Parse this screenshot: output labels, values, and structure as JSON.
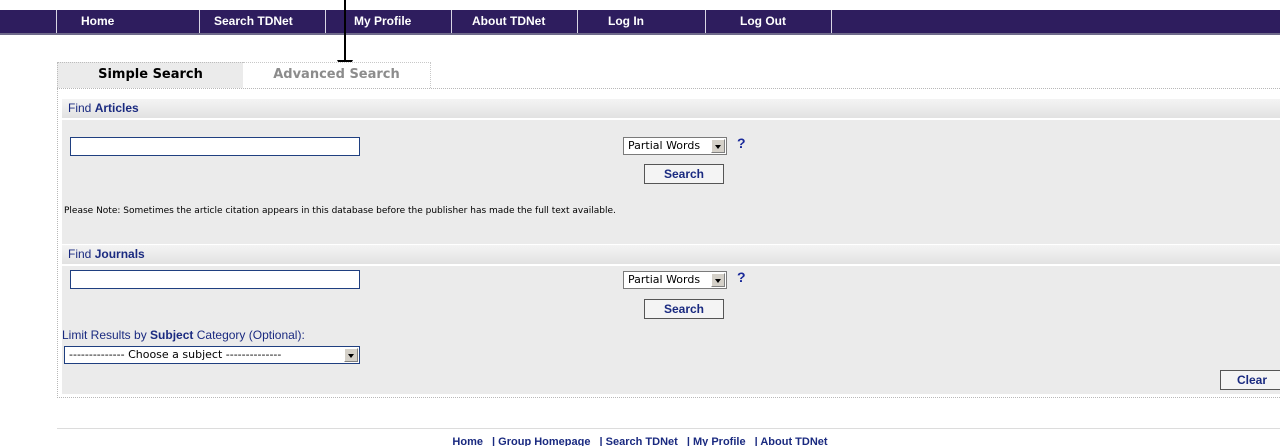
{
  "nav": {
    "items": [
      "Home",
      "Search TDNet",
      "My Profile",
      "About TDNet",
      "Log In",
      "Log Out"
    ]
  },
  "tabs": {
    "simple": "Simple Search",
    "advanced": "Advanced Search"
  },
  "articles": {
    "header_prefix": "Find",
    "header_bold": "Articles",
    "input_value": "",
    "match_select": "Partial Words",
    "help": "?",
    "search_button": "Search",
    "note": "Please Note: Sometimes the article citation appears in this database before the publisher has made the full text available."
  },
  "journals": {
    "header_prefix": "Find",
    "header_bold": "Journals",
    "input_value": "",
    "match_select": "Partial Words",
    "help": "?",
    "search_button": "Search",
    "limit_prefix": "Limit Results by",
    "limit_bold": "Subject",
    "limit_suffix": "Category (Optional):",
    "subject_select": "-------------- Choose a subject --------------",
    "clear_button": "Clear"
  },
  "footer": {
    "links": [
      "Home",
      "| Group Homepage",
      "| Search TDNet",
      "| My Profile",
      "| About TDNet"
    ]
  },
  "colors": {
    "nav_bg": "#2e1d5e",
    "link_blue": "#1a2a80",
    "panel_gray": "#ebebeb"
  }
}
